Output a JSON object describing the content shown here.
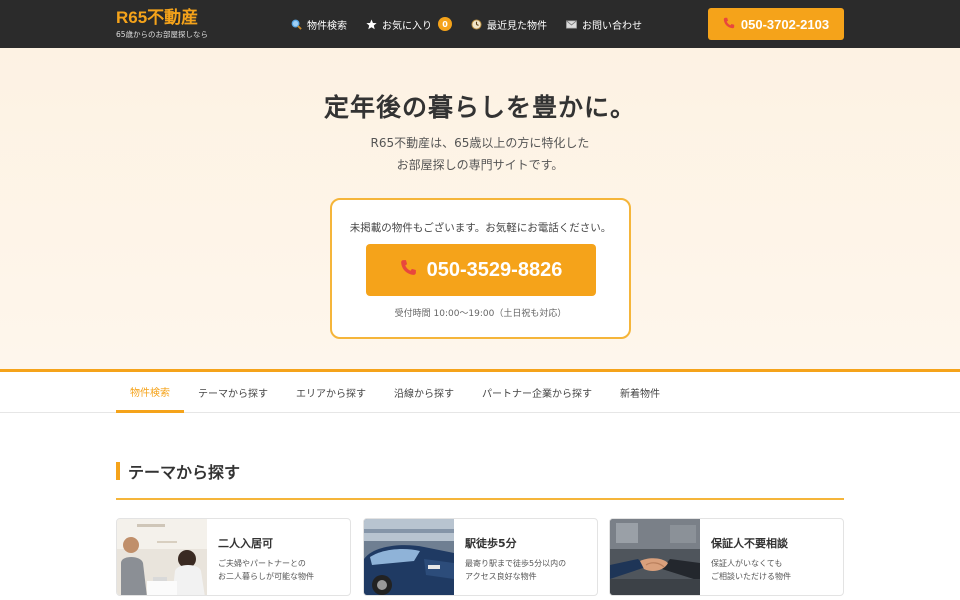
{
  "header": {
    "logo_title": "R65不動産",
    "logo_subtitle": "65歳からのお部屋探しなら",
    "nav": [
      {
        "label": "物件検索",
        "icon": "search-icon"
      },
      {
        "label": "お気に入り",
        "icon": "star-icon",
        "badge": "0"
      },
      {
        "label": "最近見た物件",
        "icon": "clock-icon"
      },
      {
        "label": "お問い合わせ",
        "icon": "mail-icon"
      }
    ],
    "phone": "050-3702-2103"
  },
  "hero": {
    "title": "定年後の暮らしを豊かに。",
    "desc_line1": "R65不動産は、65歳以上の方に特化した",
    "desc_line2": "お部屋探しの専門サイトです。",
    "cta_note": "未掲載の物件もございます。お気軽にお電話ください。",
    "cta_phone": "050-3529-8826",
    "cta_hours": "受付時間 10:00〜19:00（土日祝も対応）"
  },
  "tabs": [
    {
      "label": "物件検索",
      "active": true
    },
    {
      "label": "テーマから探す"
    },
    {
      "label": "エリアから探す"
    },
    {
      "label": "沿線から探す"
    },
    {
      "label": "パートナー企業から探す"
    },
    {
      "label": "新着物件"
    }
  ],
  "section": {
    "title": "テーマから探す",
    "cards": [
      {
        "title": "二人入居可",
        "desc1": "ご夫婦やパートナーとの",
        "desc2": "お二人暮らしが可能な物件"
      },
      {
        "title": "駅徒歩5分",
        "desc1": "最寄り駅まで徒歩5分以内の",
        "desc2": "アクセス良好な物件"
      },
      {
        "title": "保証人不要相談",
        "desc1": "保証人がいなくても",
        "desc2": "ご相談いただける物件"
      }
    ]
  },
  "colors": {
    "accent": "#f5a31a",
    "header_bg": "#2b2b2b",
    "hero_bg": "#fdf2e3"
  }
}
